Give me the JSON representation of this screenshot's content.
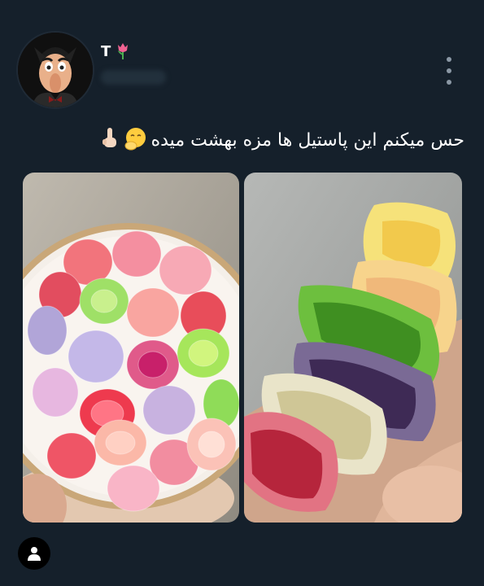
{
  "post": {
    "username": "T",
    "username_emoji": "tulip-icon",
    "caption": "حس میکنم این پاستیل ها مزه بهشت میده",
    "caption_emojis": [
      "hand-over-mouth-emoji-icon",
      "index-pointing-up-emoji-icon"
    ]
  },
  "images": [
    {
      "alt": "bowl-of-colorful-jelly-candies"
    },
    {
      "alt": "stack-of-bitten-jelly-candies"
    }
  ],
  "colors": {
    "background": "#15202b",
    "text": "#ffffff",
    "muted": "#8b98a5"
  }
}
